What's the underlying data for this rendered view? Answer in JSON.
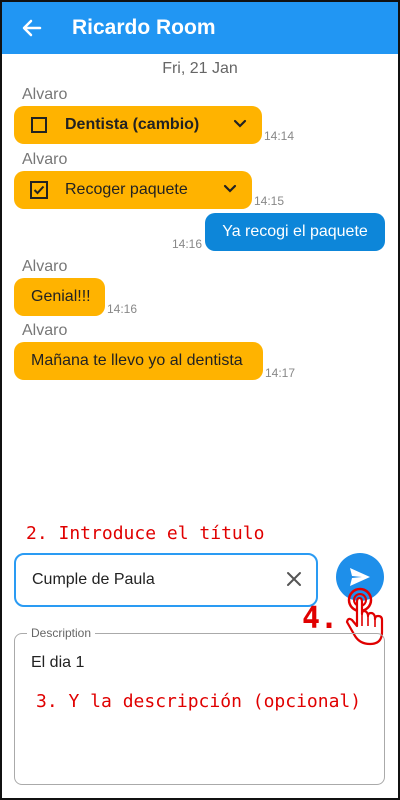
{
  "header": {
    "title": "Ricardo Room",
    "back_icon": "arrow-left-icon"
  },
  "date_separator": "Fri, 21 Jan",
  "messages": [
    {
      "sender": "Alvaro",
      "type": "task",
      "text": "Dentista (cambio)",
      "checked": false,
      "time": "14:14"
    },
    {
      "sender": "Alvaro",
      "type": "task",
      "text": "Recoger paquete",
      "checked": true,
      "time": "14:15"
    },
    {
      "sender": "",
      "type": "text",
      "text": "Ya recogi el paquete",
      "time": "14:16"
    },
    {
      "sender": "Alvaro",
      "type": "text",
      "text": "Genial!!!",
      "time": "14:16"
    },
    {
      "sender": "Alvaro",
      "type": "text",
      "text": "Mañana te llevo yo al dentista",
      "time": "14:17"
    }
  ],
  "annotations": {
    "step2": "2. Introduce el título",
    "step3": "3. Y la descripción (opcional)",
    "step4": "4."
  },
  "input": {
    "title_value": "Cumple de Paula"
  },
  "description": {
    "label": "Description",
    "value": "El dia 1"
  },
  "colors": {
    "appbar": "#2196F3",
    "incoming_bubble": "#FFB300",
    "outgoing_bubble": "#0D86D9",
    "annotation": "#e00000"
  }
}
